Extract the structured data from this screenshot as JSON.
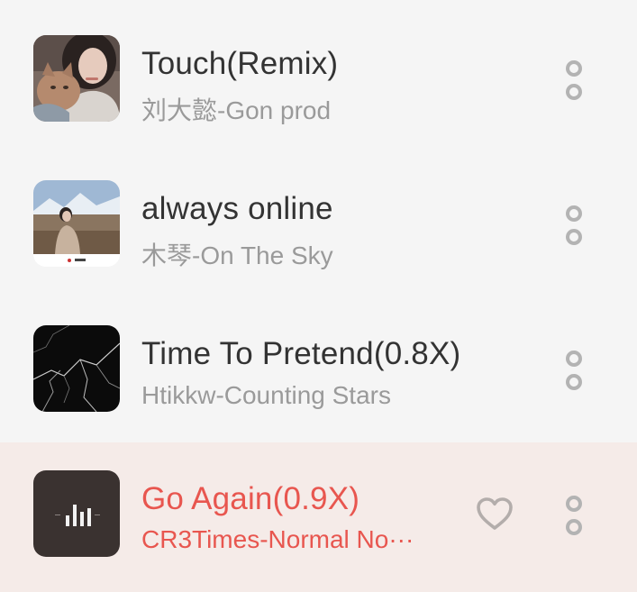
{
  "songs": [
    {
      "title": "Touch(Remix)",
      "subtitle": "刘大懿-Gon prod",
      "cover_icon": "portrait-with-cat-cover",
      "active": false
    },
    {
      "title": "always online",
      "subtitle": "木琴-On The Sky",
      "cover_icon": "snowy-mountain-portrait-cover",
      "active": false
    },
    {
      "title": "Time To Pretend(0.8X)",
      "subtitle": "Htikkw-Counting Stars",
      "cover_icon": "black-marble-cover",
      "active": false
    },
    {
      "title": "Go Again(0.9X)",
      "subtitle": "CR3Times-Normal No···",
      "cover_icon": "equalizer-bars-cover",
      "active": true
    }
  ],
  "colors": {
    "background": "#f5f5f5",
    "active_row_background": "#f5ebe8",
    "title": "#333333",
    "subtitle": "#9a9a9a",
    "active_text": "#e8564f",
    "icon_gray": "#b3b3b3"
  }
}
